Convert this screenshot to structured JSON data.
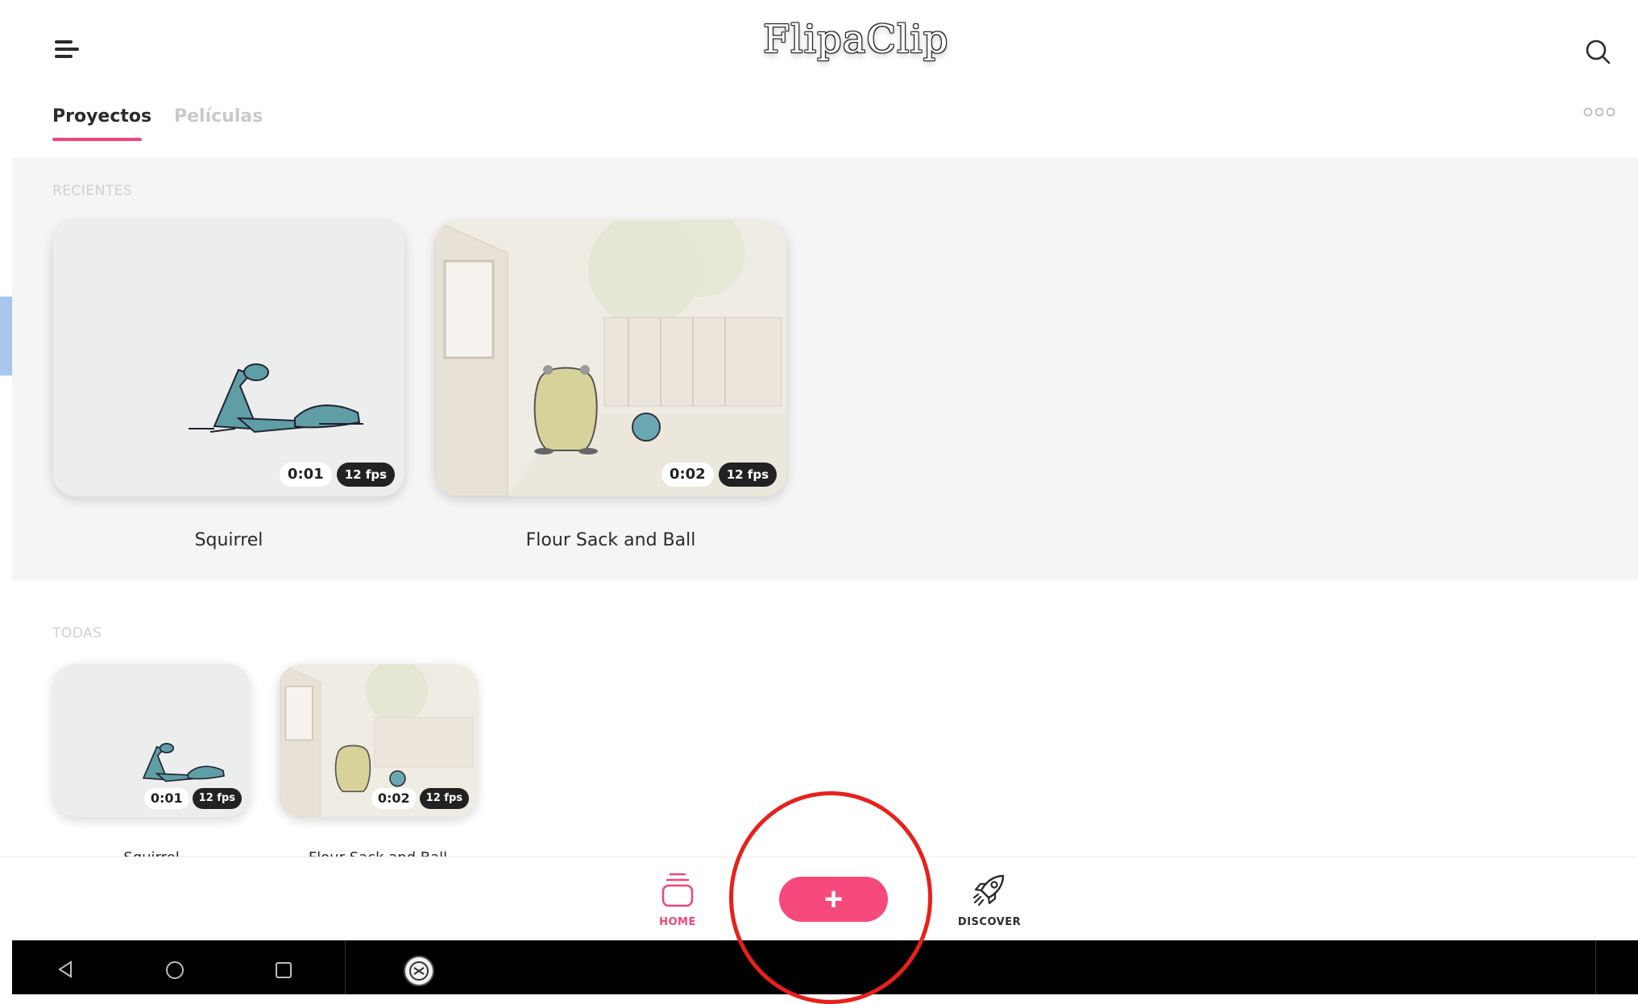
{
  "app": {
    "logo_text": "FlipaClip"
  },
  "tabs": [
    {
      "label": "Proyectos",
      "active": true
    },
    {
      "label": "Películas",
      "active": false
    }
  ],
  "sections": {
    "recent_label": "RECIENTES",
    "all_label": "TODAS"
  },
  "projects": [
    {
      "title": "Squirrel",
      "duration": "0:01",
      "fps": "12 fps"
    },
    {
      "title": "Flour Sack and Ball",
      "duration": "0:02",
      "fps": "12 fps"
    }
  ],
  "all_projects": [
    {
      "title": "Squirrel",
      "duration": "0:01",
      "fps": "12 fps"
    },
    {
      "title": "Flour Sack and Ball",
      "duration": "0:02",
      "fps": "12 fps"
    }
  ],
  "bottom_nav": {
    "home_label": "HOME",
    "add_label": "+",
    "discover_label": "DISCOVER"
  },
  "colors": {
    "accent": "#f54a7b",
    "highlight": "#e8201c"
  },
  "icons": [
    "menu-icon",
    "search-icon",
    "more-icon",
    "home-icon",
    "rocket-icon",
    "back-icon",
    "home-circle-icon",
    "recents-icon",
    "app-icon"
  ]
}
